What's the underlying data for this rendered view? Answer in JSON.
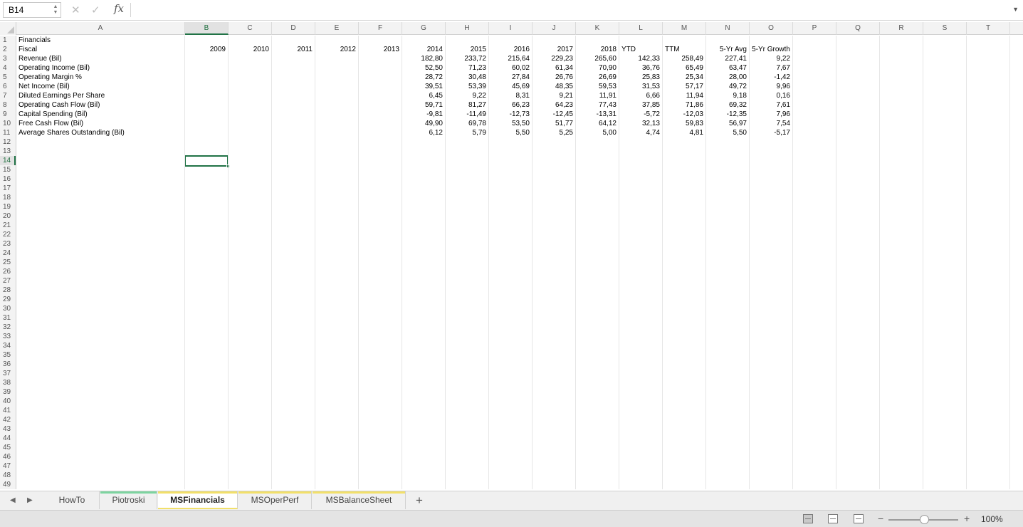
{
  "formula_bar": {
    "name_box": "B14",
    "fx": "fx",
    "formula": ""
  },
  "columns": [
    "A",
    "B",
    "C",
    "D",
    "E",
    "F",
    "G",
    "H",
    "I",
    "J",
    "K",
    "L",
    "M",
    "N",
    "O",
    "P",
    "Q",
    "R",
    "S",
    "T"
  ],
  "selected_cell": "B14",
  "rows": [
    [
      "Financials",
      "",
      "",
      "",
      "",
      "",
      "",
      "",
      "",
      "",
      "",
      "",
      "",
      "",
      "",
      "",
      "",
      "",
      "",
      ""
    ],
    [
      "Fiscal",
      "2009",
      "2010",
      "2011",
      "2012",
      "2013",
      "2014",
      "2015",
      "2016",
      "2017",
      "2018",
      "YTD",
      "TTM",
      "5-Yr Avg",
      "5-Yr Growth",
      "",
      "",
      "",
      "",
      ""
    ],
    [
      "Revenue (Bil)",
      "",
      "",
      "",
      "",
      "",
      "182,80",
      "233,72",
      "215,64",
      "229,23",
      "265,60",
      "142,33",
      "258,49",
      "227,41",
      "9,22",
      "",
      "",
      "",
      "",
      ""
    ],
    [
      "Operating Income (Bil)",
      "",
      "",
      "",
      "",
      "",
      "52,50",
      "71,23",
      "60,02",
      "61,34",
      "70,90",
      "36,76",
      "65,49",
      "63,47",
      "7,67",
      "",
      "",
      "",
      "",
      ""
    ],
    [
      "Operating Margin %",
      "",
      "",
      "",
      "",
      "",
      "28,72",
      "30,48",
      "27,84",
      "26,76",
      "26,69",
      "25,83",
      "25,34",
      "28,00",
      "-1,42",
      "",
      "",
      "",
      "",
      ""
    ],
    [
      "Net Income (Bil)",
      "",
      "",
      "",
      "",
      "",
      "39,51",
      "53,39",
      "45,69",
      "48,35",
      "59,53",
      "31,53",
      "57,17",
      "49,72",
      "9,96",
      "",
      "",
      "",
      "",
      ""
    ],
    [
      "Diluted Earnings Per Share",
      "",
      "",
      "",
      "",
      "",
      "6,45",
      "9,22",
      "8,31",
      "9,21",
      "11,91",
      "6,66",
      "11,94",
      "9,18",
      "0,16",
      "",
      "",
      "",
      "",
      ""
    ],
    [
      "Operating Cash Flow (Bil)",
      "",
      "",
      "",
      "",
      "",
      "59,71",
      "81,27",
      "66,23",
      "64,23",
      "77,43",
      "37,85",
      "71,86",
      "69,32",
      "7,61",
      "",
      "",
      "",
      "",
      ""
    ],
    [
      "Capital Spending (Bil)",
      "",
      "",
      "",
      "",
      "",
      "-9,81",
      "-11,49",
      "-12,73",
      "-12,45",
      "-13,31",
      "-5,72",
      "-12,03",
      "-12,35",
      "7,96",
      "",
      "",
      "",
      "",
      ""
    ],
    [
      "Free Cash Flow (Bil)",
      "",
      "",
      "",
      "",
      "",
      "49,90",
      "69,78",
      "53,50",
      "51,77",
      "64,12",
      "32,13",
      "59,83",
      "56,97",
      "7,54",
      "",
      "",
      "",
      "",
      ""
    ],
    [
      "Average Shares Outstanding (Bil)",
      "",
      "",
      "",
      "",
      "",
      "6,12",
      "5,79",
      "5,50",
      "5,25",
      "5,00",
      "4,74",
      "4,81",
      "5,50",
      "-5,17",
      "",
      "",
      "",
      "",
      ""
    ]
  ],
  "total_rows": 49,
  "tabs": [
    {
      "label": "HowTo",
      "color": "",
      "active": false
    },
    {
      "label": "Piotroski",
      "color": "#7dd4a0",
      "active": false
    },
    {
      "label": "MSFinancials",
      "color": "#f2e06a",
      "active": true
    },
    {
      "label": "MSOperPerf",
      "color": "#f2e06a",
      "active": false
    },
    {
      "label": "MSBalanceSheet",
      "color": "#f2e06a",
      "active": false
    }
  ],
  "add_tab": "+",
  "status": {
    "zoom": "100%",
    "zoom_minus": "−",
    "zoom_plus": "+"
  }
}
